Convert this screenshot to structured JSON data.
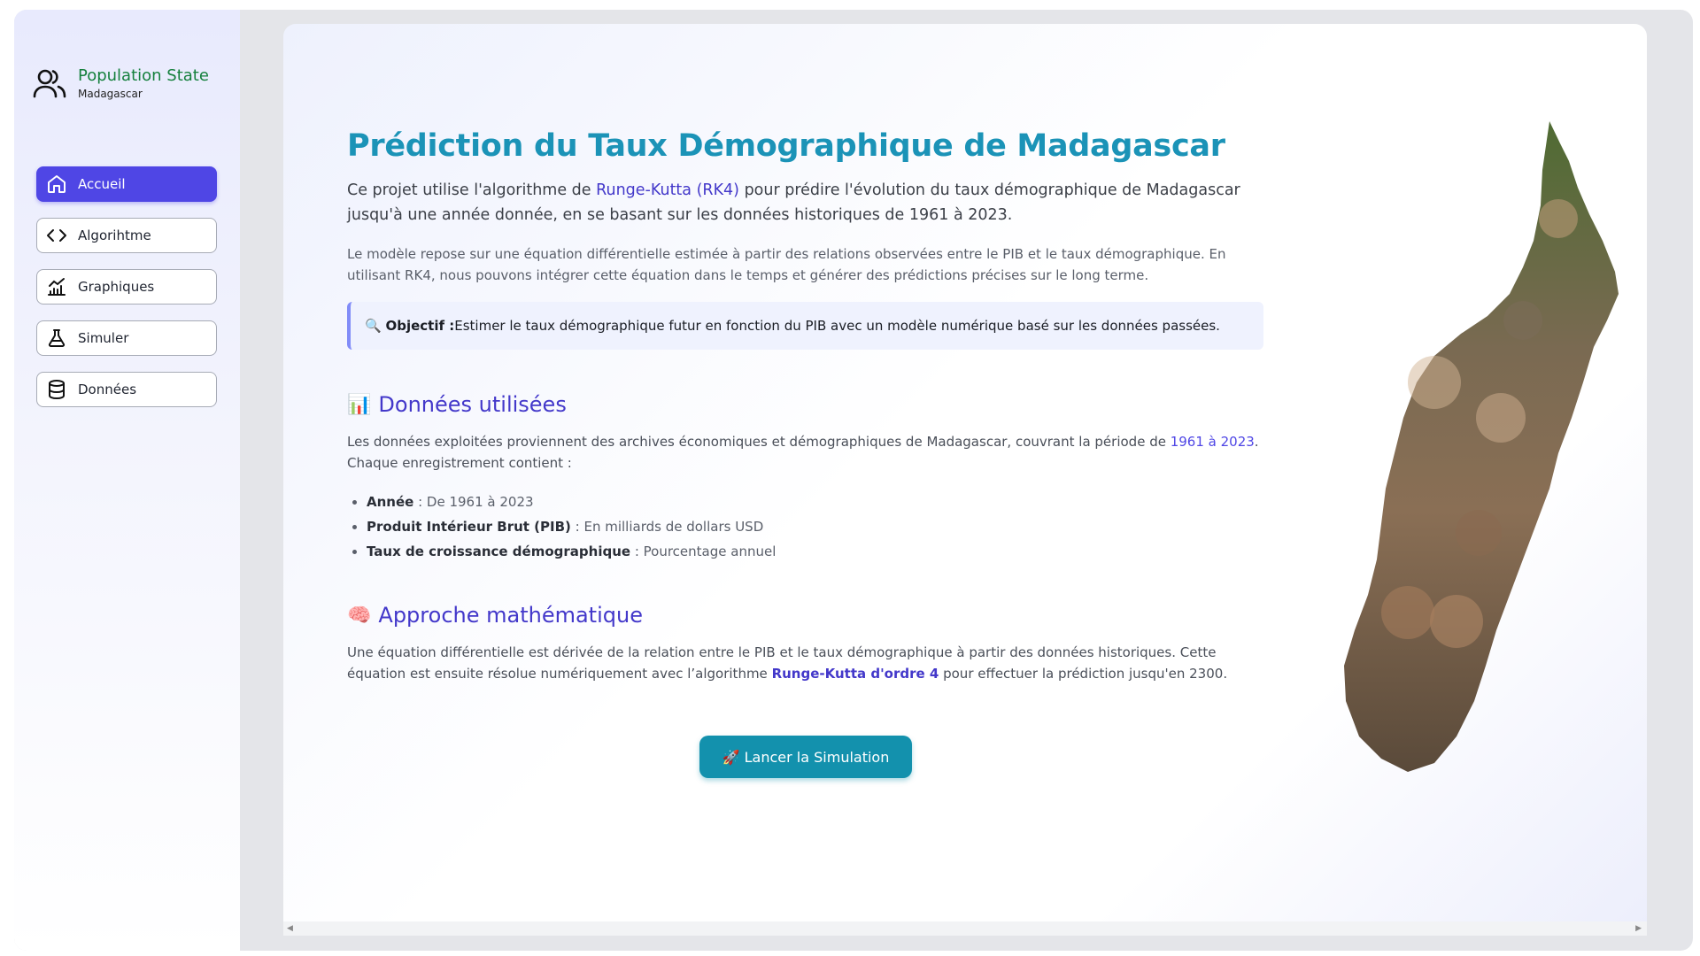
{
  "brand": {
    "title": "Population State",
    "subtitle": "Madagascar",
    "icon": "users-icon"
  },
  "nav": {
    "items": [
      {
        "label": "Accueil",
        "icon": "home-icon",
        "active": true
      },
      {
        "label": "Algorihtme",
        "icon": "code-icon",
        "active": false
      },
      {
        "label": "Graphiques",
        "icon": "chart-icon",
        "active": false
      },
      {
        "label": "Simuler",
        "icon": "flask-icon",
        "active": false
      },
      {
        "label": "Données",
        "icon": "database-icon",
        "active": false
      }
    ]
  },
  "main": {
    "title": "Prédiction du Taux Démographique de Madagascar",
    "lead_1": "Ce projet utilise l'algorithme de ",
    "lead_hl": "Runge-Kutta (RK4)",
    "lead_2": " pour prédire l'évolution du taux démographique de Madagascar jusqu'à une année donnée, en se basant sur les données historiques de 1961 à 2023.",
    "para": "Le modèle repose sur une équation différentielle estimée à partir des relations observées entre le PIB et le taux démographique. En utilisant RK4, nous pouvons intégrer cette équation dans le temps et générer des prédictions précises sur le long terme.",
    "callout_emoji": "🔍",
    "callout_label": "Objectif :",
    "callout_text": " Estimer le taux démographique futur en fonction du PIB avec un modèle numérique basé sur les données passées.",
    "section1": {
      "emoji": "📊",
      "title": "Données utilisées",
      "text_1": "Les données exploitées proviennent des archives économiques et démographiques de Madagascar, couvrant la période de ",
      "text_hl": "1961 à 2023",
      "text_2": ". Chaque enregistrement contient :",
      "items": [
        {
          "label": "Année",
          "text": " : De 1961 à 2023"
        },
        {
          "label": "Produit Intérieur Brut (PIB)",
          "text": " : En milliards de dollars USD"
        },
        {
          "label": "Taux de croissance démographique",
          "text": " : Pourcentage annuel"
        }
      ]
    },
    "section2": {
      "emoji": "🧠",
      "title": "Approche mathématique",
      "text_1": "Une équation différentielle est dérivée de la relation entre le PIB et le taux démographique à partir des données historiques. Cette équation est ensuite résolue numériquement avec l’algorithme ",
      "text_hl": "Runge-Kutta d'ordre 4",
      "text_2": " pour effectuer la prédiction jusqu'en 2300."
    },
    "button_label": "🚀 Lancer la Simulation"
  },
  "colors": {
    "accent": "#4f46e5",
    "title": "#1b93b7",
    "brand": "#15803d",
    "button": "#1391ad"
  }
}
